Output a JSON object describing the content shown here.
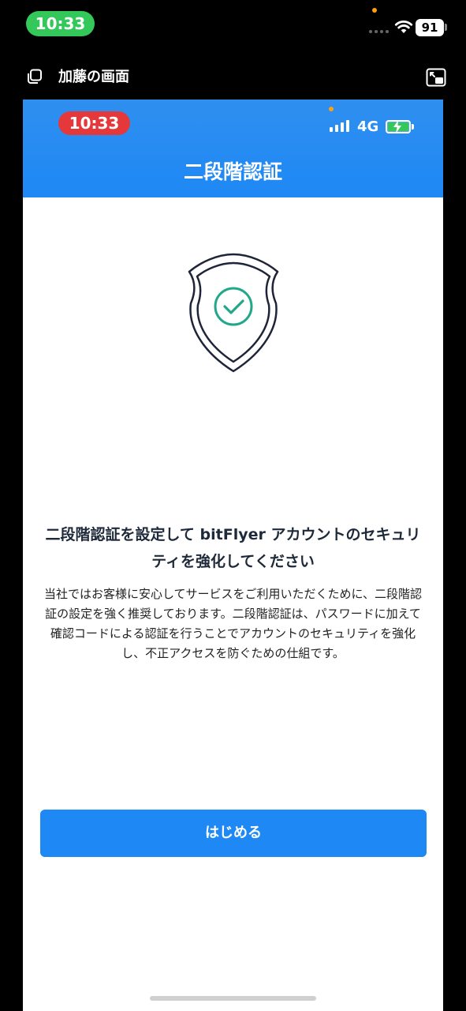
{
  "outer_status": {
    "time": "10:33",
    "battery": "91",
    "wifi_icon": "wifi-icon",
    "signal_icon": "cellular-signal-icon"
  },
  "share_bar": {
    "title": "加藤の画面",
    "share_icon": "screen-share-icon",
    "pip_icon": "picture-in-picture-icon"
  },
  "inner_status": {
    "time": "10:33",
    "network": "4G",
    "signal_icon": "cellular-signal-icon",
    "battery_icon": "battery-charging-icon"
  },
  "header": {
    "title": "二段階認証",
    "background_color": "#1e88f5"
  },
  "illustration": {
    "icon": "shield-check-icon",
    "check_color": "#21a88a"
  },
  "content": {
    "headline": "二段階認証を設定して bitFlyer アカウントのセキュリティを強化してください",
    "body": "当社ではお客様に安心してサービスをご利用いただくために、二段階認証の設定を強く推奨しております。二段階認証は、パスワードに加えて確認コードによる認証を行うことでアカウントのセキュリティを強化し、不正アクセスを防ぐための仕組です。"
  },
  "actions": {
    "start_label": "はじめる",
    "accent_color": "#1e88f5"
  }
}
